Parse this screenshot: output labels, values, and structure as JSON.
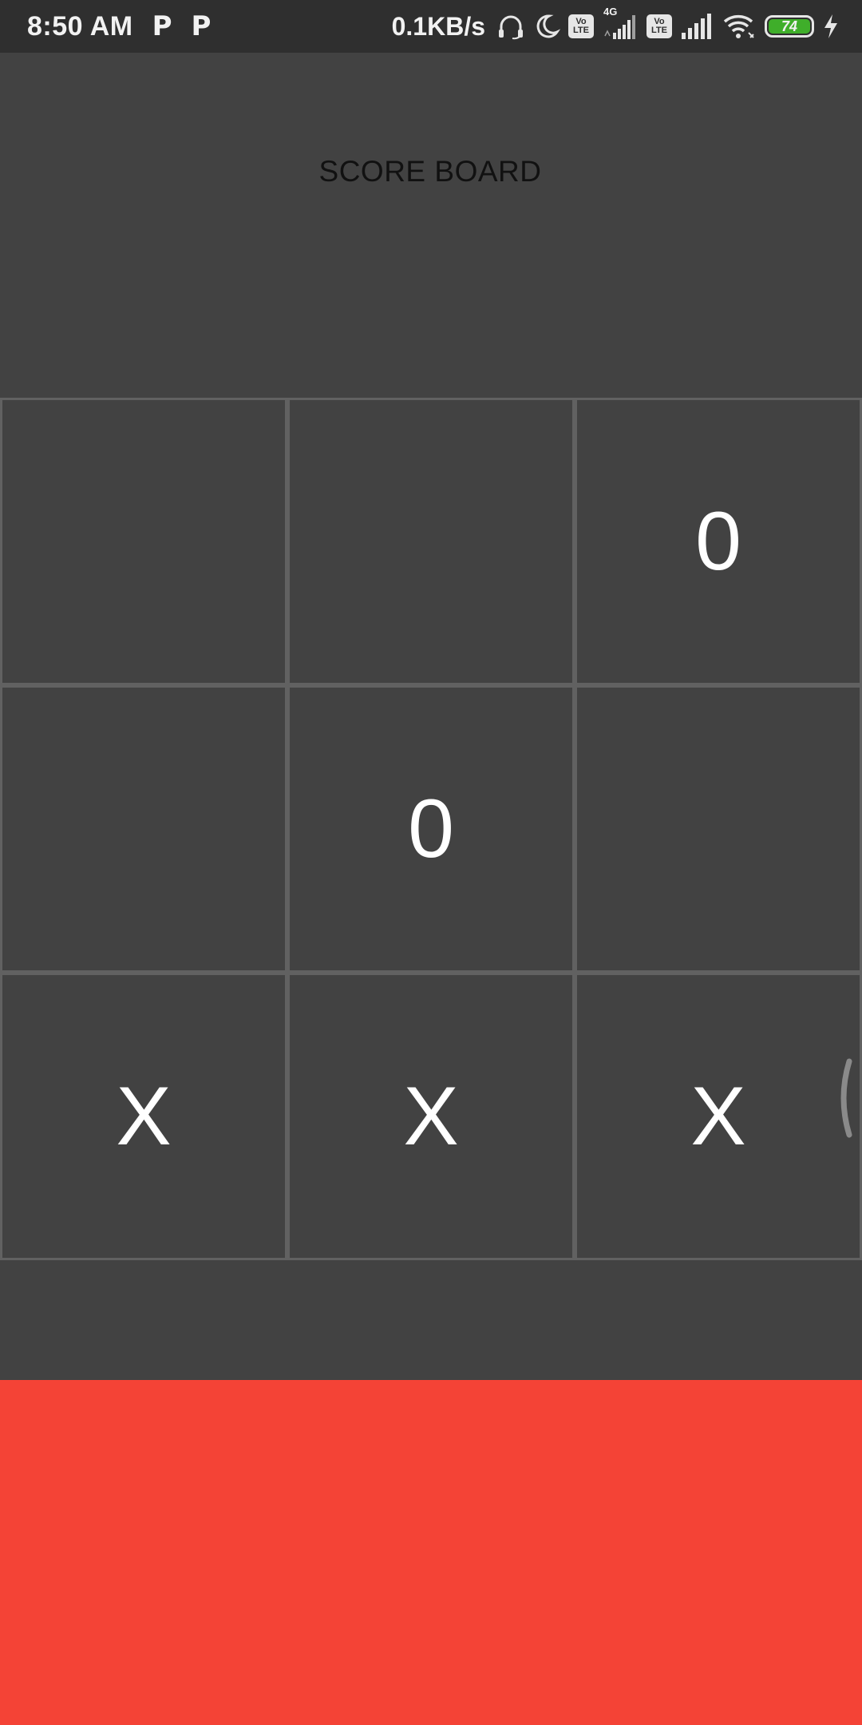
{
  "status_bar": {
    "time": "8:50 AM",
    "notif_icons": [
      "P",
      "P"
    ],
    "net_speed": "0.1KB/s",
    "network_type": "4G",
    "volte_top": "Vo",
    "volte_bottom": "LTE",
    "battery_level": "74",
    "battery_color": "#3fae2a",
    "icons": [
      "headphones-icon",
      "moon-icon",
      "volte-icon",
      "signal-icon",
      "wifi-icon",
      "battery-icon",
      "charging-icon"
    ]
  },
  "scoreboard": {
    "title": "SCORE BOARD"
  },
  "board": {
    "cells": [
      "",
      "",
      "0",
      "",
      "0",
      "",
      "X",
      "X",
      "X"
    ]
  },
  "colors": {
    "background": "#424242",
    "status_bar": "#2f2f2f",
    "grid_lines": "#616161",
    "bottom_panel": "#f44336"
  }
}
